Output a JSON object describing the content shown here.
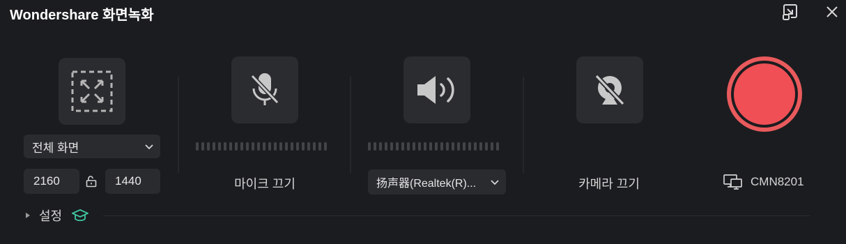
{
  "app": {
    "title": "Wondershare 화면녹화"
  },
  "capture": {
    "mode_label": "전체 화면",
    "width": "2160",
    "height": "1440"
  },
  "microphone": {
    "status_label": "마이크 끄기"
  },
  "speaker": {
    "device_label": "扬声器(Realtek(R)..."
  },
  "camera": {
    "status_label": "카메라 끄기"
  },
  "screen": {
    "device_name": "CMN8201"
  },
  "settings": {
    "label": "설정"
  },
  "colors": {
    "background": "#1b1c1f",
    "tile": "#2b2c30",
    "record": "#ef4f55",
    "accent_green": "#3fc7a2"
  },
  "icons": [
    "expand-window-icon",
    "close-icon",
    "fullscreen-area-icon",
    "chevron-down-icon",
    "unlock-icon",
    "mic-off-icon",
    "speaker-icon",
    "camera-off-icon",
    "monitor-icon",
    "caret-right-icon",
    "graduation-cap-icon"
  ]
}
